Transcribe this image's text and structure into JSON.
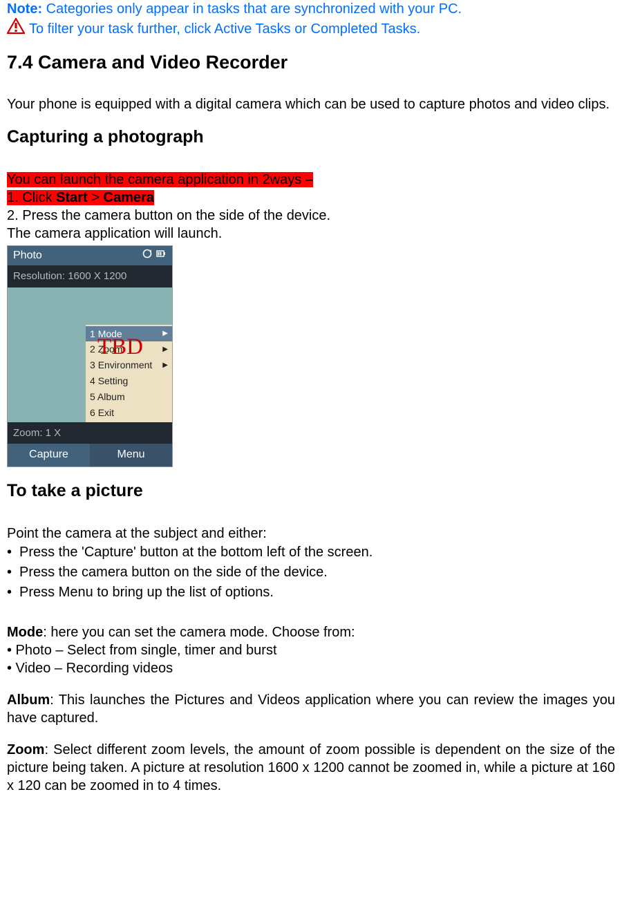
{
  "note": {
    "label": "Note:",
    "text": " Categories only appear in tasks that are synchronized with your PC.",
    "warning_text": " To filter your task further, click Active Tasks or Completed Tasks."
  },
  "heading_main": "7.4 Camera and Video Recorder",
  "intro": "Your phone is equipped with a digital camera which can be used to capture photos and video clips.",
  "heading_capture": "Capturing a photograph",
  "launch": {
    "line1": "You can launch the camera application in 2ways –",
    "line2_prefix": "1. Click ",
    "line2_start": "Start",
    "line2_sep": " > ",
    "line2_camera": "Camera",
    "line3": "2. Press the camera button on the side of the device.",
    "line4": "The camera application will launch."
  },
  "screenshot": {
    "title": "Photo",
    "resolution": "Resolution: 1600 X 1200",
    "zoom_label": "Zoom: 1 X",
    "menu": [
      {
        "n": "1",
        "label": "Mode",
        "arrow": true,
        "selected": true
      },
      {
        "n": "2",
        "label": "Zoom",
        "arrow": true,
        "selected": false
      },
      {
        "n": "3",
        "label": "Environment",
        "arrow": true,
        "selected": false
      },
      {
        "n": "4",
        "label": "Setting",
        "arrow": false,
        "selected": false
      },
      {
        "n": "5",
        "label": "Album",
        "arrow": false,
        "selected": false
      },
      {
        "n": "6",
        "label": "Exit",
        "arrow": false,
        "selected": false
      }
    ],
    "softkey_left": "Capture",
    "softkey_right": "Menu",
    "tbd": "TBD"
  },
  "heading_take": "To take a picture",
  "take_intro": "Point the camera at the subject and either:",
  "take_bullets": [
    "Press the 'Capture' button at the bottom left of the screen.",
    "Press the camera button on the side of the device.",
    "Press Menu to bring up the list of options."
  ],
  "mode": {
    "term": "Mode",
    "desc": ": here you can set the camera mode. Choose from:",
    "items": [
      "• Photo – Select from single, timer and burst",
      "• Video – Recording videos"
    ]
  },
  "album": {
    "term": "Album",
    "desc": ": This launches the Pictures and Videos application where you can review the images you have captured."
  },
  "zoom": {
    "term": "Zoom",
    "desc": ": Select different zoom levels, the amount of zoom possible is dependent on the size of the picture being taken. A picture at resolution 1600 x 1200 cannot be zoomed in, while a picture at 160 x 120 can be zoomed in to 4 times."
  }
}
